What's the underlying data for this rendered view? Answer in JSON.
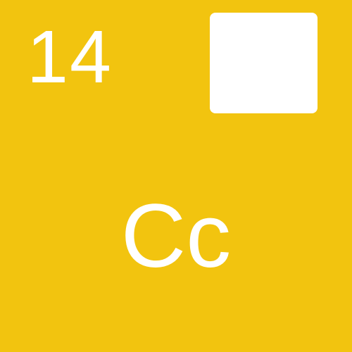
{
  "card": {
    "number": "14",
    "letters": "Cc",
    "background_color": "#F2C40F",
    "foreground_color": "#FFFFFF"
  }
}
